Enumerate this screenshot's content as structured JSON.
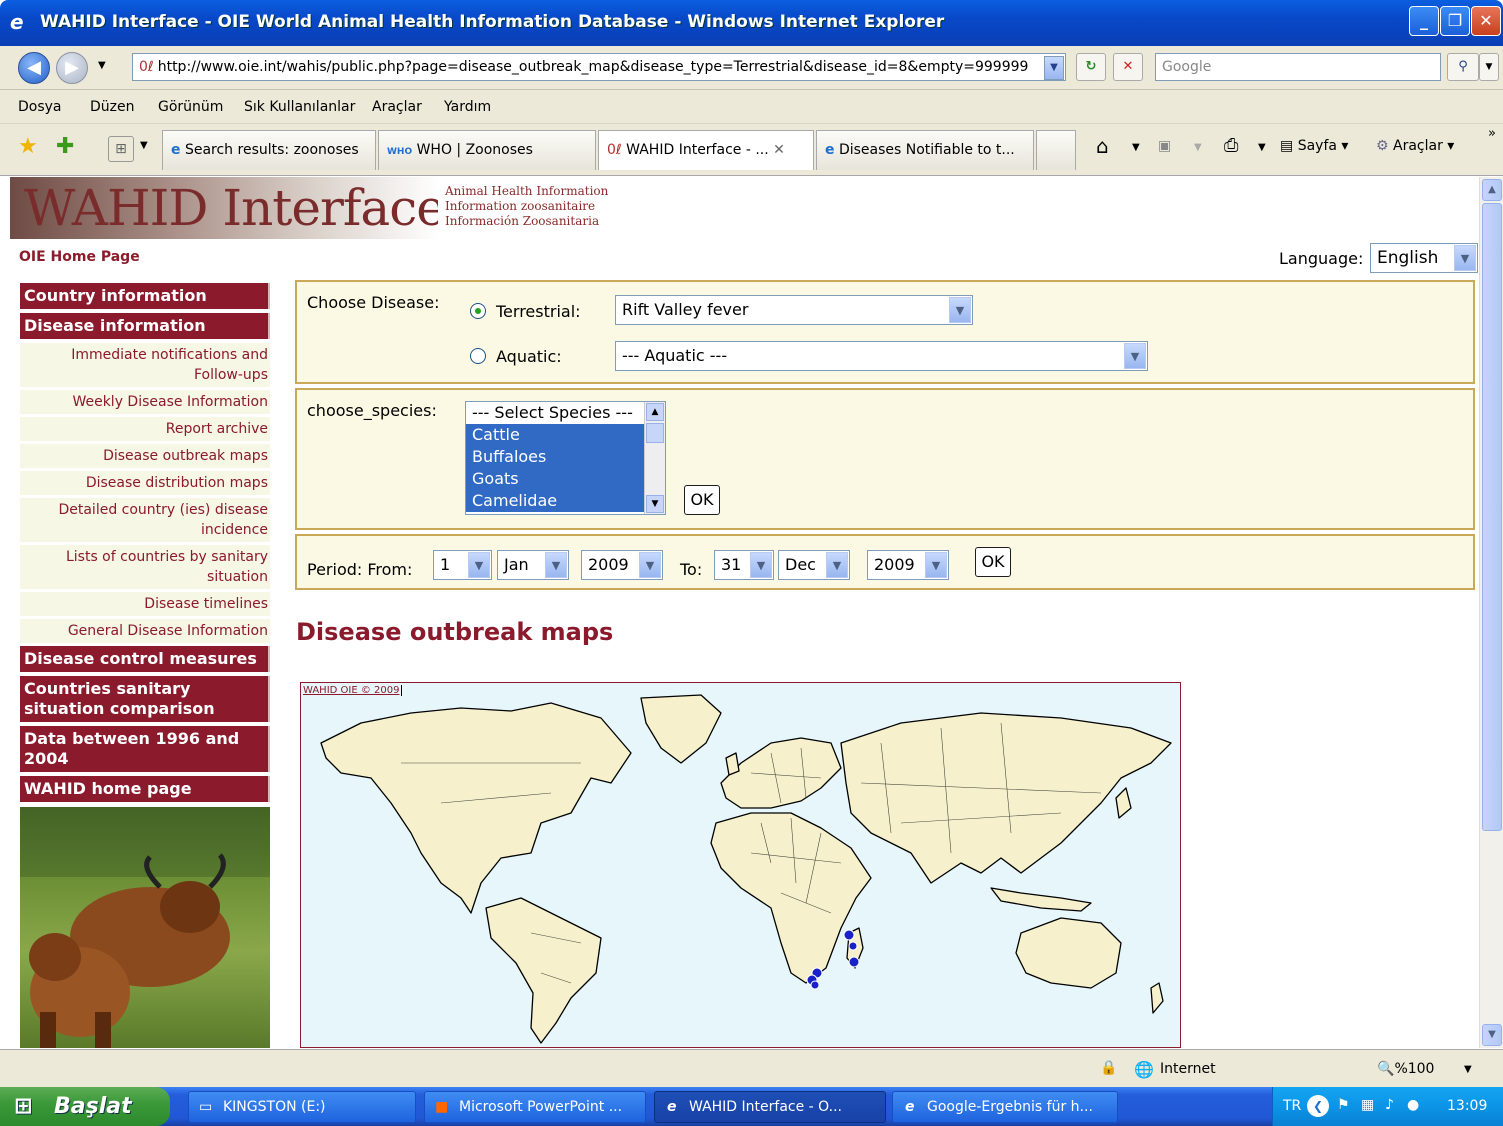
{
  "window": {
    "title": "WAHID Interface - OIE World Animal Health Information Database - Windows Internet Explorer"
  },
  "address": {
    "url": "http://www.oie.int/wahis/public.php?page=disease_outbreak_map&disease_type=Terrestrial&disease_id=8&empty=999999",
    "search_placeholder": "Google"
  },
  "menu": [
    "Dosya",
    "Düzen",
    "Görünüm",
    "Sık Kullanılanlar",
    "Araçlar",
    "Yardım"
  ],
  "tabs": [
    {
      "label": "Search results: zoonoses"
    },
    {
      "label": "WHO | Zoonoses"
    },
    {
      "label": "WAHID Interface - ..."
    },
    {
      "label": "Diseases Notifiable to t..."
    }
  ],
  "toolbar": {
    "page": "Sayfa",
    "tools": "Araçlar"
  },
  "site": {
    "banner_title": "WAHID Interface",
    "banner_lines": [
      "Animal Health Information",
      "Information zoosanitaire",
      "Información Zoosanitaria"
    ],
    "home_link": "OIE Home Page",
    "language_label": "Language:",
    "language_value": "English"
  },
  "nav": {
    "country_information": "Country information",
    "disease_information": "Disease information",
    "sub": [
      "Immediate notifications and Follow-ups",
      "Weekly Disease Information",
      "Report archive",
      "Disease outbreak maps",
      "Disease distribution maps",
      "Detailed country (ies) disease incidence",
      "Lists of countries by sanitary situation",
      "Disease timelines",
      "General Disease Information"
    ],
    "disease_control": "Disease control measures",
    "countries_comparison": "Countries sanitary situation comparison",
    "data_1996": "Data between 1996 and 2004",
    "wahid_home": "WAHID home page"
  },
  "form": {
    "choose_disease": "Choose Disease:",
    "terrestrial_label": "Terrestrial:",
    "terrestrial_value": "Rift Valley fever",
    "aquatic_label": "Aquatic:",
    "aquatic_value": "--- Aquatic ---",
    "choose_species": "choose_species:",
    "species": [
      "--- Select Species ---",
      "Cattle",
      "Buffaloes",
      "Goats",
      "Camelidae"
    ],
    "ok": "OK",
    "period_from": "Period: From:",
    "from_day": "1",
    "from_month": "Jan",
    "from_year": "2009",
    "to_label": "To:",
    "to_day": "31",
    "to_month": "Dec",
    "to_year": "2009"
  },
  "map": {
    "heading": "Disease outbreak maps",
    "credit": "WAHID OIE © 2009"
  },
  "status": {
    "zone": "Internet",
    "zoom": "%100"
  },
  "taskbar": {
    "start": "Başlat",
    "items": [
      "KINGSTON (E:)",
      "Microsoft PowerPoint ...",
      "WAHID Interface - O...",
      "Google-Ergebnis für h..."
    ],
    "lang": "TR",
    "clock": "13:09"
  }
}
